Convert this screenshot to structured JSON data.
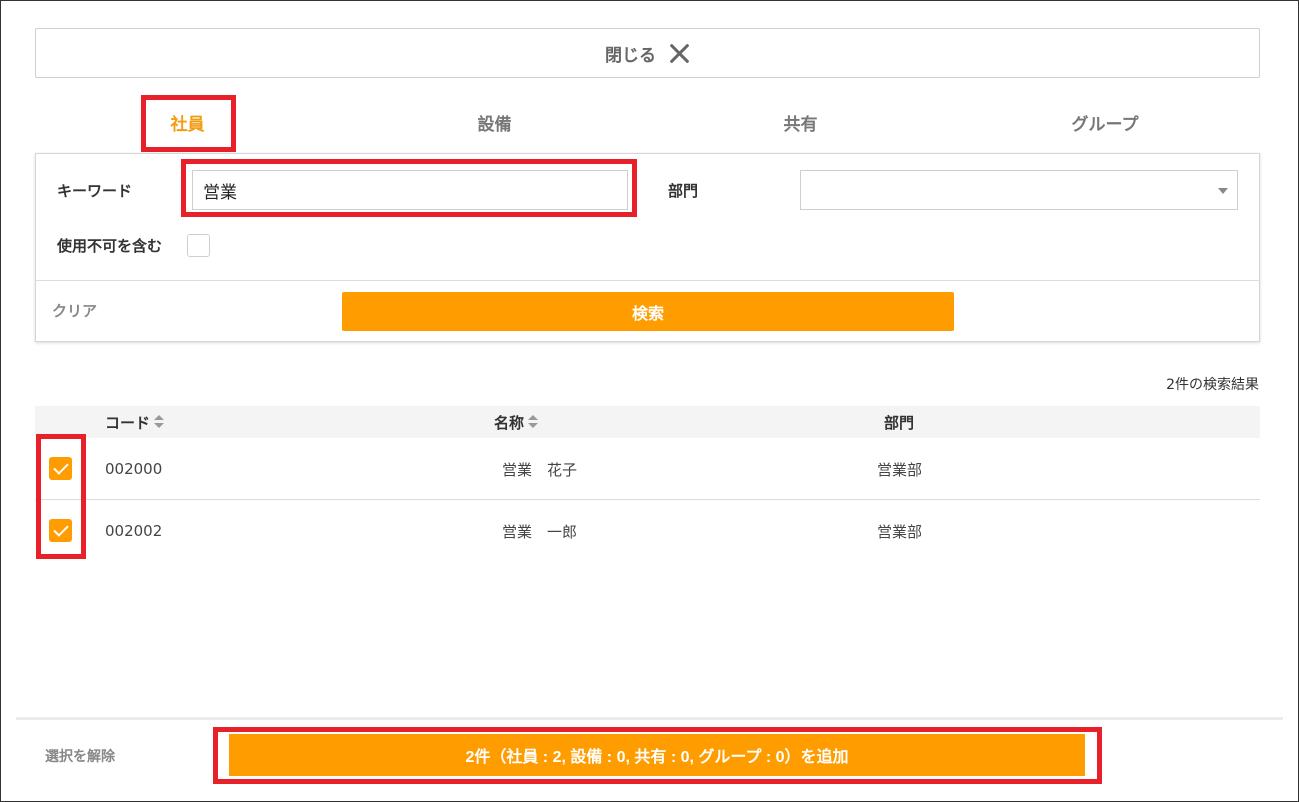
{
  "close_bar": {
    "label": "閉じる",
    "icon": "close-icon"
  },
  "tabs": [
    {
      "label": "社員",
      "active": true
    },
    {
      "label": "設備",
      "active": false
    },
    {
      "label": "共有",
      "active": false
    },
    {
      "label": "グループ",
      "active": false
    }
  ],
  "search": {
    "keyword_label": "キーワード",
    "keyword_value": "営業",
    "dept_label": "部門",
    "dept_value": "",
    "include_unusable_label": "使用不可を含む",
    "include_unusable_checked": false,
    "clear_label": "クリア",
    "search_button": "検索"
  },
  "results": {
    "count_text": "2件の検索結果",
    "columns": [
      "コード",
      "名称",
      "部門"
    ],
    "rows": [
      {
        "checked": true,
        "code": "002000",
        "name": "営業　花子",
        "dept": "営業部"
      },
      {
        "checked": true,
        "code": "002002",
        "name": "営業　一郎",
        "dept": "営業部"
      }
    ]
  },
  "footer": {
    "unselect_label": "選択を解除",
    "add_button": "2件（社員 : 2, 設備 : 0, 共有 : 0, グループ : 0）を追加"
  },
  "colors": {
    "accent": "#ff9c00",
    "highlight": "#e8202a"
  }
}
